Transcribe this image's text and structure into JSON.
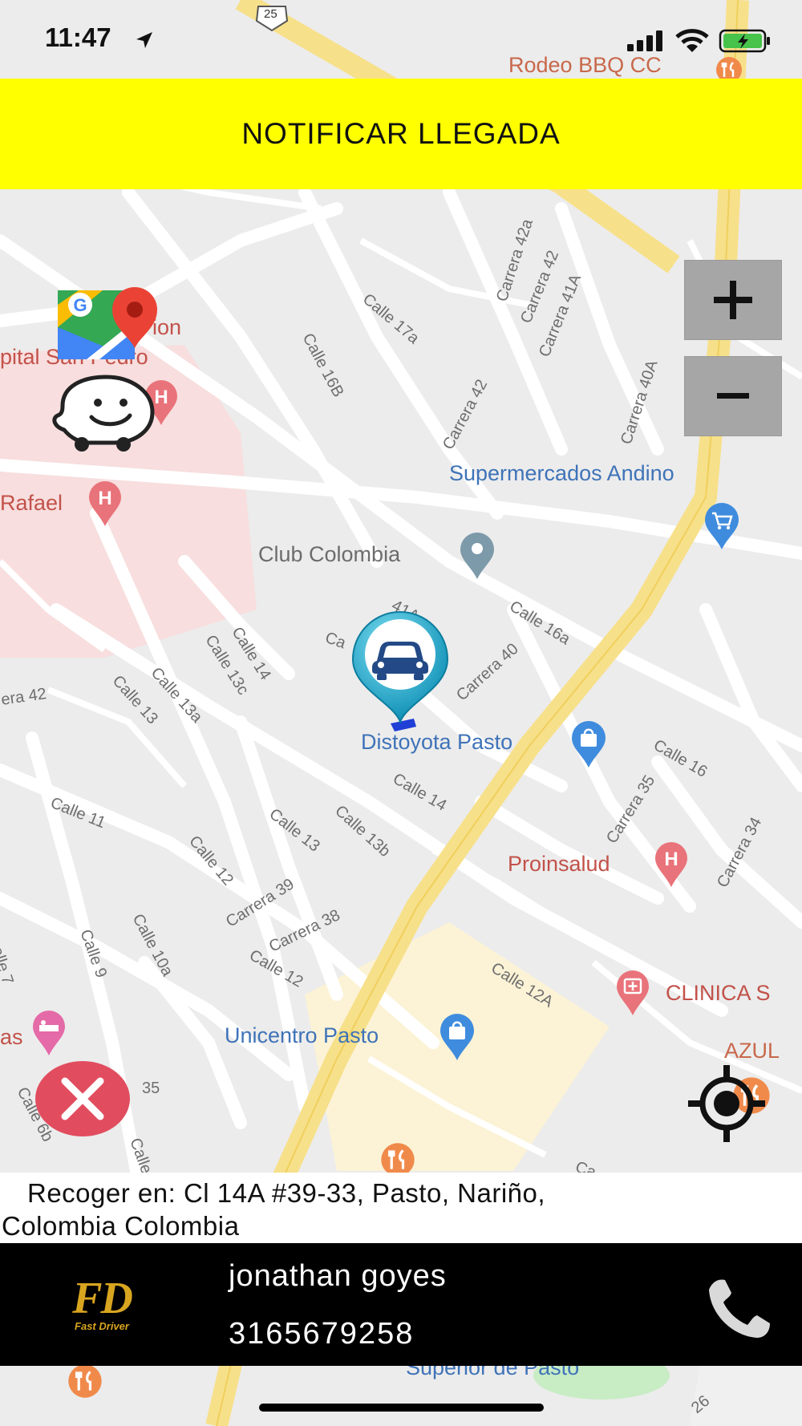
{
  "status_bar": {
    "time": "11:47",
    "route_shield": "25"
  },
  "notify_button": {
    "label": "NOTIFICAR LLEGADA"
  },
  "map": {
    "pois": {
      "rodeo": "Rodeo BBQ CC",
      "supermercados": "Supermercados Andino",
      "club_colombia": "Club Colombia",
      "distoyota": "Distoyota Pasto",
      "proinsalud": "Proinsalud",
      "clinica": "CLINICA S",
      "unicentro": "Unicentro Pasto",
      "azul": "AZUL",
      "rafael": "Rafael",
      "hospital_top": "ion",
      "hospital_bottom": "pital San Pedro",
      "as": "as",
      "superior": "Superior de Pasto"
    },
    "streets": {
      "calle_17a": "Calle 17a",
      "calle_16b": "Calle 16B",
      "carrera_42a": "Carrera 42a",
      "carrera_42_top": "Carrera 42",
      "carrera_41a_top": "Carrera 41A",
      "carrera_42_mid": "Carrera 42",
      "carrera_40a": "Carrera 40A",
      "calle_16a": "Calle 16a",
      "calle_41a": "41A",
      "carrera_40": "Carrera 40",
      "ca": "Ca",
      "calle_14_a": "Calle 14",
      "calle_13c": "Calle 13c",
      "calle_13a": "Calle 13a",
      "calle_13_left": "Calle 13",
      "era_42": "era 42",
      "calle_16": "Calle 16",
      "carrera_35": "Carrera 35",
      "carrera_34": "Carrera 34",
      "calle_14_b": "Calle 14",
      "calle_11": "Calle 11",
      "calle_13_mid": "Calle 13",
      "calle_13b": "Calle 13b",
      "calle_12_a": "Calle 12",
      "carrera_39": "Carrera 39",
      "carrera_38": "Carrera 38",
      "calle_12_b": "Calle 12",
      "calle_9": "Calle 9",
      "calle_10a": "Calle 10a",
      "calle_7": "alle 7",
      "calle_12a": "Calle 12A",
      "n35": "35",
      "calle_6b": "Calle 6b",
      "calle_bottom": "Calle",
      "ca_bottom": "Ca",
      "n26": "26"
    }
  },
  "pickup": {
    "line1": "Recoger en: Cl 14A #39-33, Pasto, Nariño,",
    "line2": "Colombia  Colombia"
  },
  "driver": {
    "name": "jonathan goyes",
    "phone": "3165679258",
    "logo_text": "FD",
    "logo_subtitle": "Fast Driver"
  },
  "icons": {
    "google_maps": "google-maps-icon",
    "waze": "waze-icon",
    "zoom_in": "plus-icon",
    "zoom_out": "minus-icon",
    "cancel": "close-icon",
    "locate": "crosshair-icon",
    "car_marker": "car-marker-icon",
    "phone": "phone-icon"
  },
  "colors": {
    "notify_bg": "#ffff00",
    "cancel_bg": "#e14d5f",
    "poi_blue": "#3f73b8",
    "poi_red": "#c2524a",
    "marker_teal": "#1b9fc2",
    "logo_gold": "#d8a520"
  }
}
